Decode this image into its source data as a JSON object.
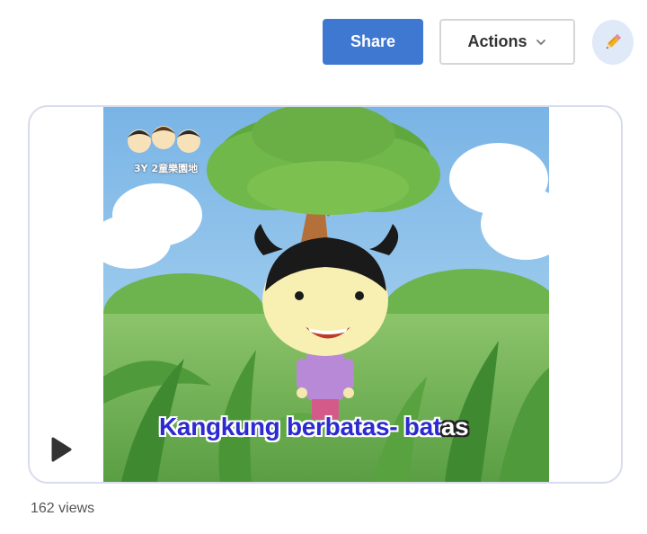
{
  "toolbar": {
    "share_label": "Share",
    "actions_label": "Actions",
    "edit_icon": "pencil-icon"
  },
  "video": {
    "caption_main": "Kangkung berbatas- bat",
    "caption_rest": "as",
    "logo_text": "3Y 2童樂園地",
    "play_icon": "play-icon"
  },
  "stats": {
    "views": "162 views"
  },
  "colors": {
    "accent": "#3f78d0",
    "caption": "#2c2ad0",
    "card_border": "#d8dcec",
    "edit_bg": "#dfe9f8"
  }
}
